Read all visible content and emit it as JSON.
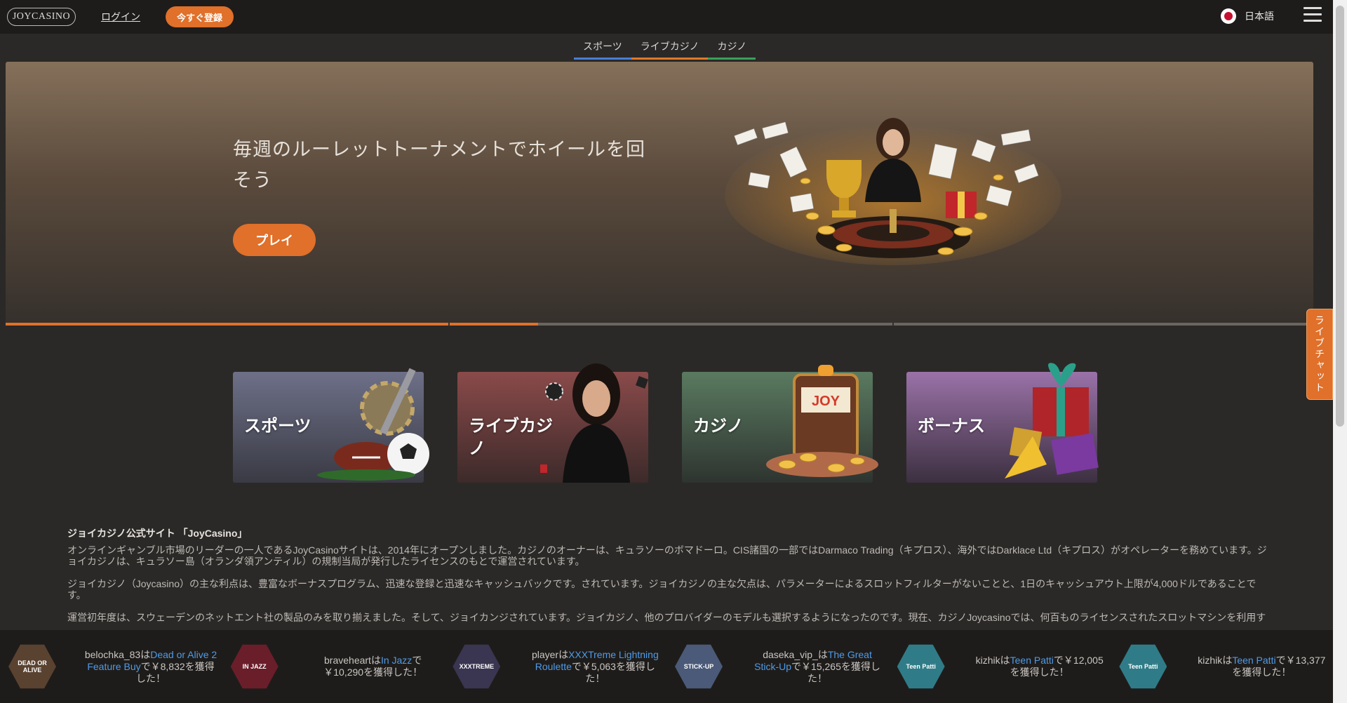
{
  "header": {
    "logo_text": "JOYCASINO",
    "login_label": "ログイン",
    "register_label": "今すぐ登録",
    "language_label": "日本語"
  },
  "subnav": {
    "tabs": [
      {
        "label": "スポーツ",
        "color": "#4a7fd4"
      },
      {
        "label": "ライブカジノ",
        "color": "#e07a2a"
      },
      {
        "label": "カジノ",
        "color": "#3aa05a"
      }
    ]
  },
  "hero": {
    "title": "毎週のルーレットトーナメントでホイールを回そう",
    "play_label": "プレイ",
    "slides_total": 3,
    "active_slide_progress": 0.2
  },
  "livechat": {
    "label": "ライブチャット"
  },
  "categories": [
    {
      "label": "スポーツ",
      "icon": "sports-balls-icon",
      "color": "#5c5f74"
    },
    {
      "label": "ライブカジノ",
      "icon": "live-dealer-icon",
      "color": "#7a4a4a"
    },
    {
      "label": "カジノ",
      "icon": "slot-machine-icon",
      "color": "#4c6450"
    },
    {
      "label": "ボーナス",
      "icon": "gift-box-icon",
      "color": "#8a6298"
    }
  ],
  "article": {
    "heading": "ジョイカジノ公式サイト 「JoyCasino」",
    "paragraphs": [
      "オンラインギャンブル市場のリーダーの一人であるJoyCasinoサイトは、2014年にオープンしました。カジノのオーナーは、キュラソーのボマドーロ。CIS諸国の一部ではDarmaco Trading（キプロス）、海外ではDarklace Ltd（キプロス）がオペレーターを務めています。ジョイカジノは、キュラソー島（オランダ領アンティル）の規制当局が発行したライセンスのもとで運営されています。",
      "ジョイカジノ（Joycasino）の主な利点は、豊富なボーナスプログラム、迅速な登録と迅速なキャッシュバックです。されています。ジョイカジノの主な欠点は、パラメーターによるスロットフィルターがないことと、1日のキャッシュアウト上限が4,000ドルであることです。",
      "運営初年度は、スウェーデンのネットエント社の製品のみを取り揃えました。そして、ジョイカンジされています。ジョイカジノ、他のプロバイダーのモデルも選択するようになったのです。現在、カジノJoycasinoでは、何百ものライセンスされたスロットマシンを利用す"
    ]
  },
  "winners": [
    {
      "user": "belochka_83",
      "game": "Dead or Alive 2 Feature Buy",
      "amount": "￥8,832",
      "thumb_text": "DEAD OR ALIVE",
      "thumb_color": "#5a4230"
    },
    {
      "user": "braveheart",
      "game": "In Jazz",
      "amount": "￥10,290",
      "thumb_text": "IN JAZZ",
      "thumb_color": "#6a1e2a"
    },
    {
      "user": "player",
      "game": "XXXTreme Lightning Roulette",
      "amount": "￥5,063",
      "thumb_text": "XXXTREME",
      "thumb_color": "#3a3550"
    },
    {
      "user": "daseka_vip_",
      "game": "The Great Stick-Up",
      "amount": "￥15,265",
      "thumb_text": "STICK-UP",
      "thumb_color": "#4a5a78"
    },
    {
      "user": "kizhik",
      "game": "Teen Patti",
      "amount": "￥12,005",
      "thumb_text": "Teen Patti",
      "thumb_color": "#2f7c88"
    },
    {
      "user": "kizhik",
      "game": "Teen Patti",
      "amount": "￥13,377",
      "thumb_text": "Teen Patti",
      "thumb_color": "#2f7c88"
    }
  ],
  "winner_strings": {
    "ha": "は",
    "de": "で",
    "won_suffix": "を獲得した！"
  }
}
